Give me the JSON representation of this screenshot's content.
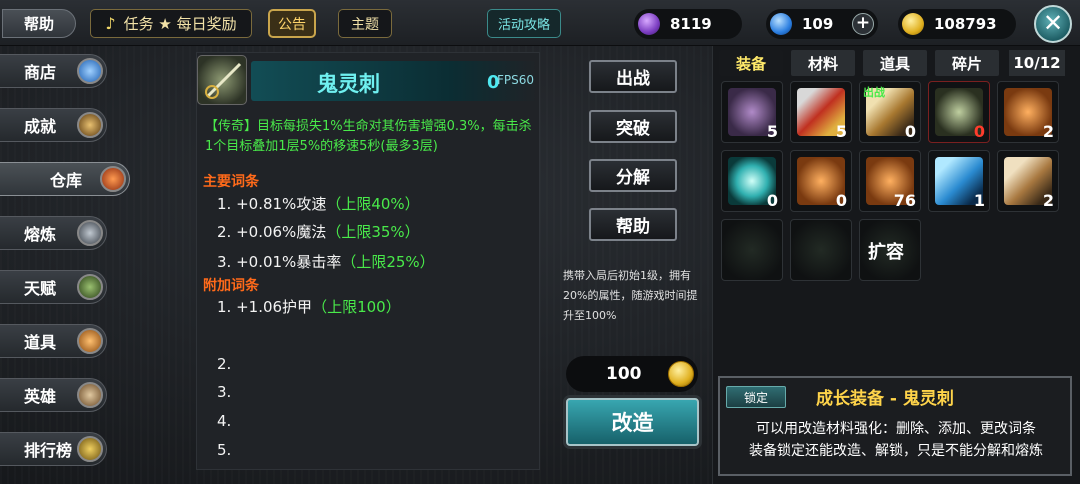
{
  "topbar": {
    "help": "帮助",
    "quest_note": "♪",
    "quest": "任务 ★ 每日奖励",
    "announcement": "公告",
    "theme": "主题",
    "guide": "活动攻略",
    "feathers": "8119",
    "gems": "109",
    "plus": "+",
    "gold": "108793",
    "close": "✕"
  },
  "sidebar": {
    "items": [
      {
        "label": "商店"
      },
      {
        "label": "成就"
      },
      {
        "label": "仓库"
      },
      {
        "label": "熔炼"
      },
      {
        "label": "天赋"
      },
      {
        "label": "道具"
      },
      {
        "label": "英雄"
      },
      {
        "label": "排行榜"
      }
    ]
  },
  "detail": {
    "name": "鬼灵刺",
    "level": "0",
    "fps": "FPS60",
    "description": "【传奇】目标每损失1%生命对其伤害增强0.3%，每击杀1个目标叠加1层5%的移速5秒(最多3层)",
    "main_title": "主要词条",
    "main_stats": [
      {
        "num": "1.",
        "text": "+0.81%攻速",
        "limit": "（上限40%）"
      },
      {
        "num": "2.",
        "text": "+0.06%魔法",
        "limit": "（上限35%）"
      },
      {
        "num": "3.",
        "text": "+0.01%暴击率",
        "limit": "（上限25%）"
      }
    ],
    "extra_title": "附加词条",
    "extra_stats": [
      {
        "num": "1.",
        "text": "+1.06护甲",
        "limit": "（上限100）"
      },
      {
        "num": "2.",
        "text": "",
        "limit": ""
      },
      {
        "num": "3.",
        "text": "",
        "limit": ""
      },
      {
        "num": "4.",
        "text": "",
        "limit": ""
      },
      {
        "num": "5.",
        "text": "",
        "limit": ""
      }
    ]
  },
  "actions": {
    "equip": "出战",
    "breakthrough": "突破",
    "decompose": "分解",
    "help": "帮助",
    "hint": "携带入局后初始1级，拥有20%的属性，随游戏时间提升至100%",
    "cost": "100",
    "refine": "改造"
  },
  "inventory": {
    "tabs": [
      "装备",
      "材料",
      "道具",
      "碎片"
    ],
    "count": "10/12",
    "slots": [
      {
        "count": "5",
        "tag": "",
        "icon": "crossbow-icon"
      },
      {
        "count": "5",
        "tag": "",
        "icon": "sword-icon"
      },
      {
        "count": "0",
        "tag": "出战",
        "icon": "dagger-icon"
      },
      {
        "count": "0",
        "tag": "",
        "icon": "ghost-spike-icon"
      },
      {
        "count": "2",
        "tag": "",
        "icon": "gauntlet-icon"
      },
      {
        "count": "0",
        "tag": "",
        "icon": "orb-icon"
      },
      {
        "count": "0",
        "tag": "",
        "icon": "gauntlet-icon"
      },
      {
        "count": "76",
        "tag": "",
        "icon": "gauntlet-icon"
      },
      {
        "count": "1",
        "tag": "",
        "icon": "bow-icon"
      },
      {
        "count": "2",
        "tag": "",
        "icon": "blade-icon"
      }
    ],
    "expand": "扩容"
  },
  "info": {
    "lock": "锁定",
    "title": "成长装备 - 鬼灵刺",
    "line1": "可以用改造材料强化：删除、添加、更改词条",
    "line2": "装备锁定还能改造、解锁，只是不能分解和熔炼"
  },
  "colors": {
    "accent_teal": "#38a6b0",
    "legendary_green": "#49ea4a",
    "section_orange": "#ff6a1a",
    "title_gold": "#ffd44a"
  }
}
